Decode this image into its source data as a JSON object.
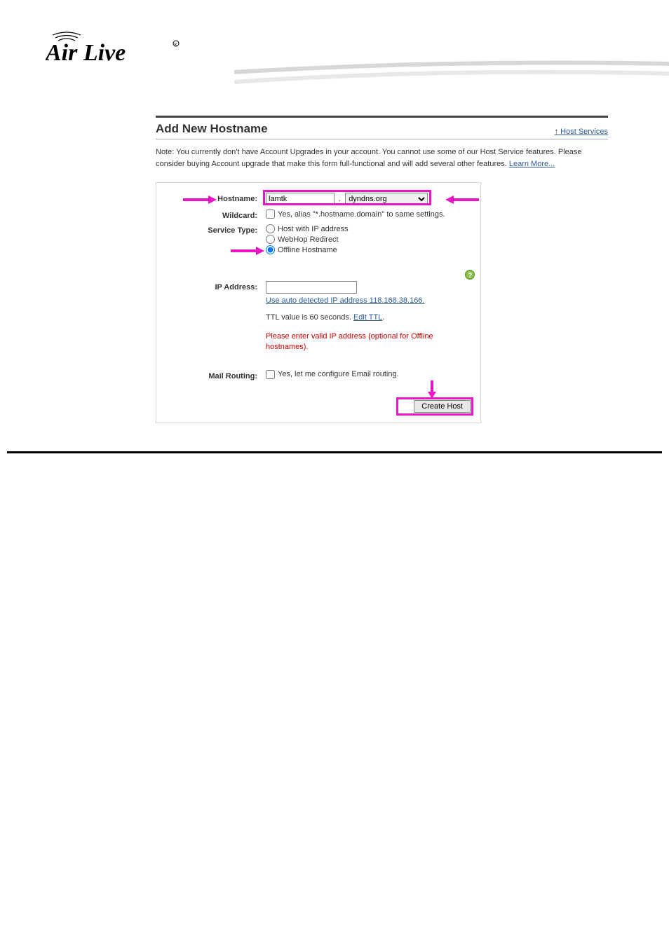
{
  "brand": "Air Live",
  "title": "Add New Hostname",
  "nav_link": "Host Services",
  "note_prefix": "Note: You currently don't have Account Upgrades in your account. You cannot use some of our Host Service features. Please consider buying Account upgrade that make this form full-functional and will add several other features. ",
  "learn_more": "Learn More...",
  "labels": {
    "hostname": "Hostname:",
    "wildcard": "Wildcard:",
    "service_type": "Service Type:",
    "ip_address": "IP Address:",
    "mail_routing": "Mail Routing:"
  },
  "hostname": {
    "value": "lamtk",
    "domain": "dyndns.org"
  },
  "wildcard_text": "Yes, alias \"*.hostname.domain\" to same settings.",
  "service_types": {
    "host_ip": "Host with IP address",
    "webhop": "WebHop Redirect",
    "offline": "Offline Hostname"
  },
  "ip_link": "Use auto detected IP address 118.168.38.166.",
  "ttl_text": "TTL value is 60 seconds. ",
  "ttl_link": "Edit TTL",
  "ip_error": "Please enter valid IP address (optional for Offline hostnames).",
  "mail_text": "Yes, let me configure Email routing.",
  "create_btn": "Create Host"
}
